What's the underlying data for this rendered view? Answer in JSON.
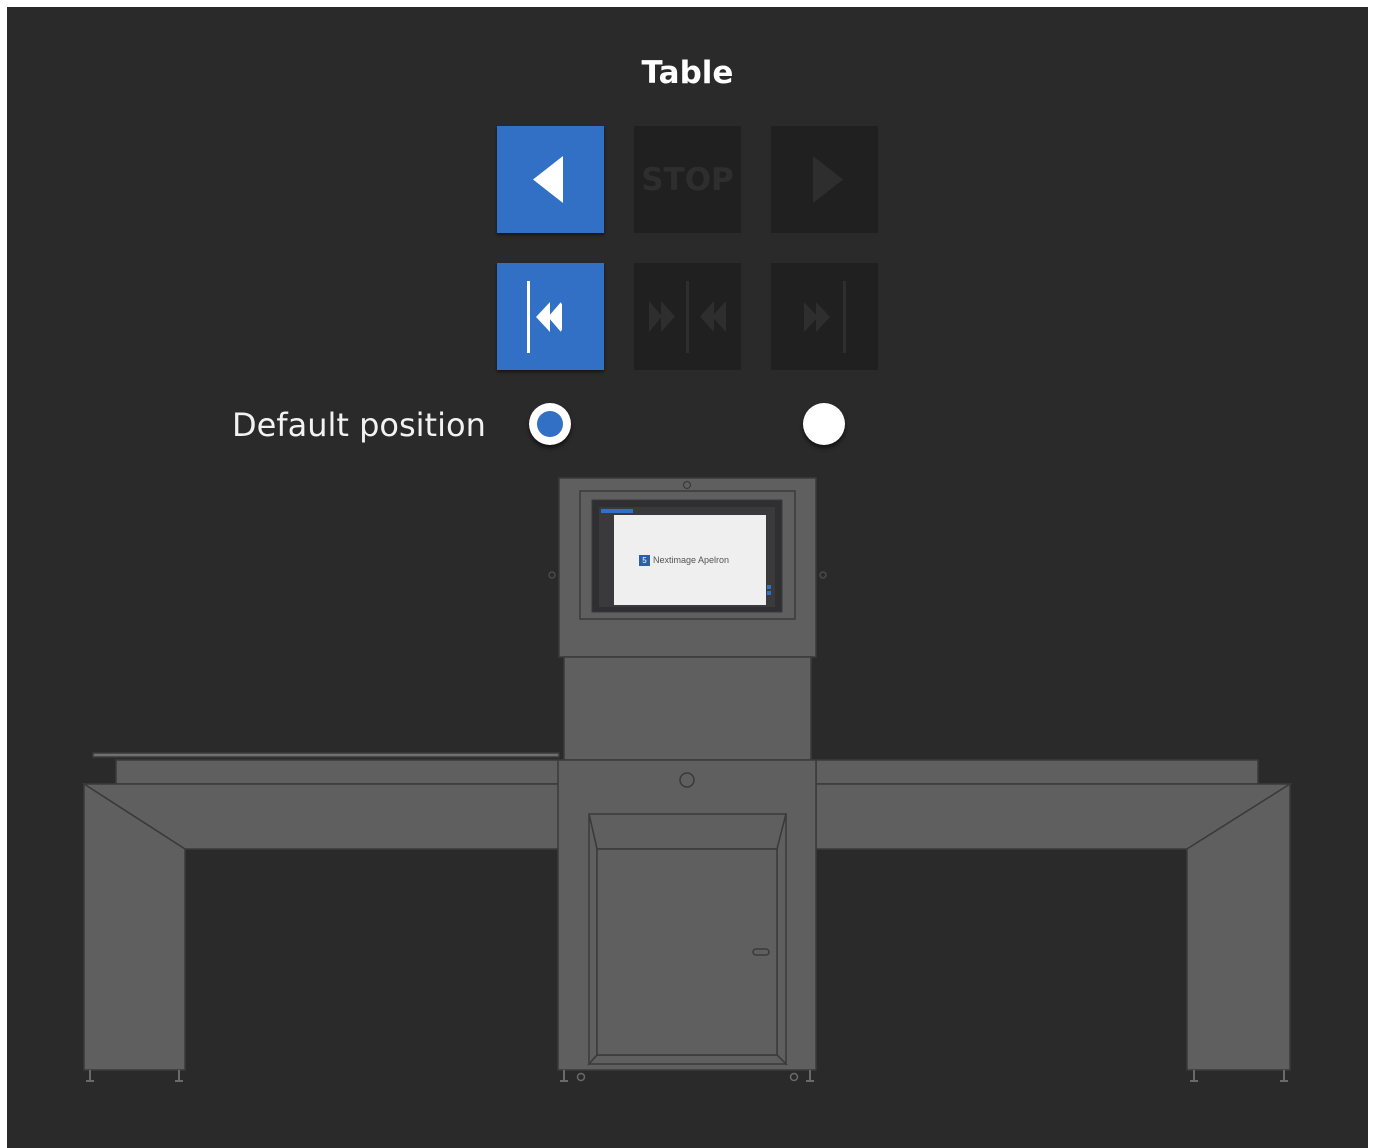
{
  "panel": {
    "title": "Table"
  },
  "controls": {
    "move_left": {
      "icon": "triangle-left-icon",
      "state": "active"
    },
    "stop": {
      "label": "STOP",
      "state": "disabled"
    },
    "move_right": {
      "icon": "triangle-right-icon",
      "state": "disabled"
    },
    "go_to_left_end": {
      "icon": "skip-to-left-icon",
      "state": "active"
    },
    "go_to_center": {
      "icon": "center-converge-icon",
      "state": "disabled"
    },
    "go_to_right_end": {
      "icon": "skip-to-right-icon",
      "state": "disabled"
    }
  },
  "default_position": {
    "label": "Default position",
    "options": [
      {
        "name": "left",
        "selected": true
      },
      {
        "name": "right",
        "selected": false
      }
    ]
  },
  "machine_screen": {
    "brand_text": "Nextimage Apelron",
    "brand_badge": "5"
  },
  "colors": {
    "accent": "#3170c5",
    "panel_bg": "#2a2a2a",
    "disabled_button": "#202020",
    "machine_body": "#5f5f60"
  }
}
